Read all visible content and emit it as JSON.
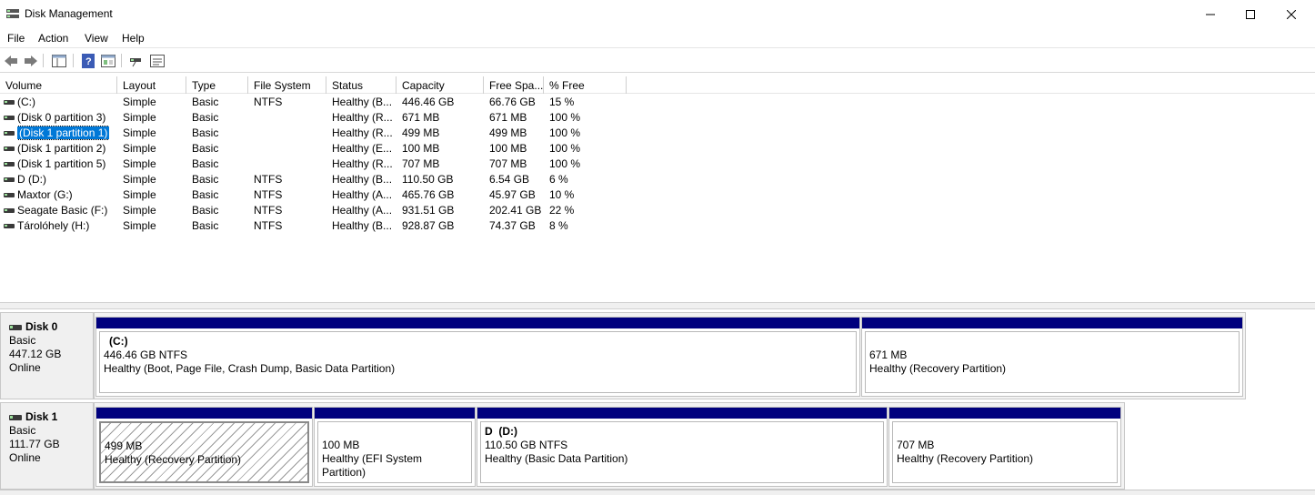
{
  "window": {
    "title": "Disk Management",
    "controls": [
      "minimize",
      "maximize",
      "close"
    ]
  },
  "menu": [
    "File",
    "Action",
    "View",
    "Help"
  ],
  "toolbar": {
    "buttons": [
      "back-icon",
      "forward-icon",
      "console-tree-icon",
      "help-icon",
      "properties-icon",
      "connect-icon",
      "disk-list-icon"
    ]
  },
  "volume_list": {
    "columns": [
      "Volume",
      "Layout",
      "Type",
      "File System",
      "Status",
      "Capacity",
      "Free Spa...",
      "% Free"
    ],
    "rows": [
      {
        "volume": " (C:)",
        "layout": "Simple",
        "type": "Basic",
        "fs": "NTFS",
        "status": "Healthy (B...",
        "capacity": "446.46 GB",
        "free": "66.76 GB",
        "pct": "15 %"
      },
      {
        "volume": "(Disk 0 partition 3)",
        "layout": "Simple",
        "type": "Basic",
        "fs": "",
        "status": "Healthy (R...",
        "capacity": "671 MB",
        "free": "671 MB",
        "pct": "100 %"
      },
      {
        "volume": "(Disk 1 partition 1)",
        "layout": "Simple",
        "type": "Basic",
        "fs": "",
        "status": "Healthy (R...",
        "capacity": "499 MB",
        "free": "499 MB",
        "pct": "100 %"
      },
      {
        "volume": "(Disk 1 partition 2)",
        "layout": "Simple",
        "type": "Basic",
        "fs": "",
        "status": "Healthy (E...",
        "capacity": "100 MB",
        "free": "100 MB",
        "pct": "100 %"
      },
      {
        "volume": "(Disk 1 partition 5)",
        "layout": "Simple",
        "type": "Basic",
        "fs": "",
        "status": "Healthy (R...",
        "capacity": "707 MB",
        "free": "707 MB",
        "pct": "100 %"
      },
      {
        "volume": "D (D:)",
        "layout": "Simple",
        "type": "Basic",
        "fs": "NTFS",
        "status": "Healthy (B...",
        "capacity": "110.50 GB",
        "free": "6.54 GB",
        "pct": "6 %"
      },
      {
        "volume": "Maxtor (G:)",
        "layout": "Simple",
        "type": "Basic",
        "fs": "NTFS",
        "status": "Healthy (A...",
        "capacity": "465.76 GB",
        "free": "45.97 GB",
        "pct": "10 %"
      },
      {
        "volume": "Seagate Basic (F:)",
        "layout": "Simple",
        "type": "Basic",
        "fs": "NTFS",
        "status": "Healthy (A...",
        "capacity": "931.51 GB",
        "free": "202.41 GB",
        "pct": "22 %"
      },
      {
        "volume": "Tárolóhely (H:)",
        "layout": "Simple",
        "type": "Basic",
        "fs": "NTFS",
        "status": "Healthy (B...",
        "capacity": "928.87 GB",
        "free": "74.37 GB",
        "pct": "8 %"
      }
    ],
    "selected_index": 2
  },
  "disks": [
    {
      "name": "Disk 0",
      "type": "Basic",
      "size": "447.12 GB",
      "state": "Online",
      "partitions": [
        {
          "name": "(C:)",
          "size": "446.46 GB NTFS",
          "status": "Healthy (Boot, Page File, Crash Dump, Basic Data Partition)"
        },
        {
          "name": "",
          "size": "671 MB",
          "status": "Healthy (Recovery Partition)"
        }
      ]
    },
    {
      "name": "Disk 1",
      "type": "Basic",
      "size": "111.77 GB",
      "state": "Online",
      "partitions": [
        {
          "name": "",
          "size": "499 MB",
          "status": "Healthy (Recovery Partition)",
          "selected": true
        },
        {
          "name": "",
          "size": "100 MB",
          "status": "Healthy (EFI System Partition)"
        },
        {
          "name": "D  (D:)",
          "size": "110.50 GB NTFS",
          "status": "Healthy (Basic Data Partition)"
        },
        {
          "name": "",
          "size": "707 MB",
          "status": "Healthy (Recovery Partition)"
        }
      ]
    }
  ],
  "colors": {
    "partition_bar": "#00007e",
    "selection": "#0078d7"
  }
}
